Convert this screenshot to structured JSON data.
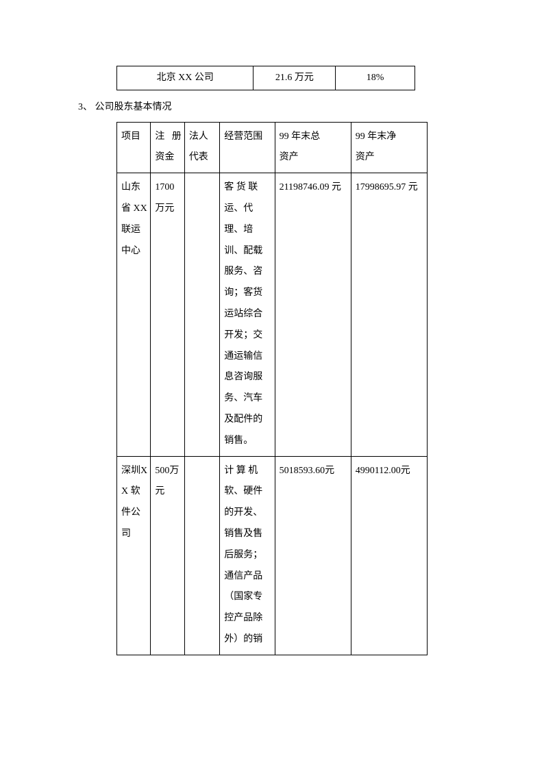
{
  "table1": {
    "company": "北京 XX 公司",
    "amount": "21.6 万元",
    "percent": "18%"
  },
  "section_heading": "3、 公司股东基本情况",
  "table2": {
    "headers": {
      "project": "项目",
      "capital_line1": "注 册",
      "capital_line2": "资金",
      "legal": "法人代表",
      "scope": "经营范围",
      "total_assets_line1": "99 年末总",
      "total_assets_line2": "资产",
      "net_assets_line1": "99 年末净",
      "net_assets_line2": "资产"
    },
    "rows": [
      {
        "project": "山东省 XX联运中心",
        "capital": "1700万元",
        "legal": "",
        "scope": "客 货 联运、代理、培训、配载服务、咨询；客货运站综合开发；交通运输信息咨询服务、汽车及配件的销售。",
        "total_assets": "21198746.09 元",
        "net_assets": "17998695.97 元"
      },
      {
        "project": "深圳XX 软件公司",
        "capital": "500万元",
        "legal": "",
        "scope": "计 算 机软、硬件的开发、销售及售后服务；通信产品（国家专控产品除外）的销",
        "total_assets": "5018593.60元",
        "net_assets": "4990112.00元"
      }
    ]
  }
}
